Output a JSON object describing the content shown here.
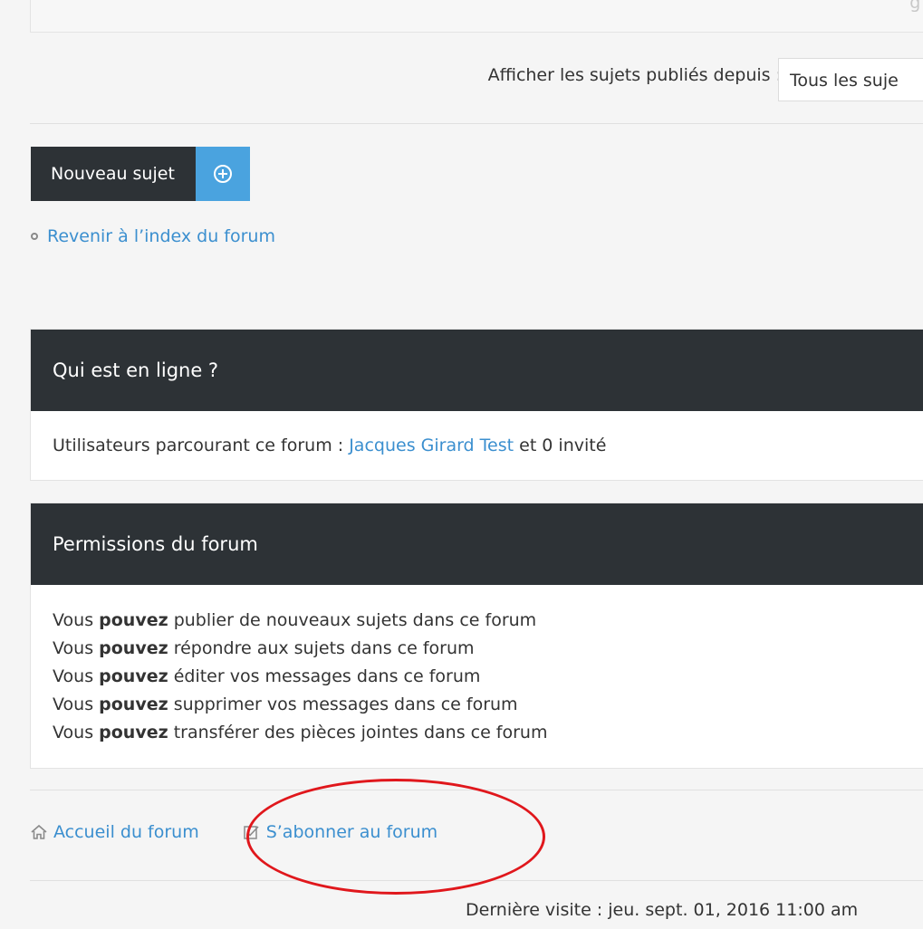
{
  "top": {
    "corner_text": "ge"
  },
  "filter": {
    "label": "Afficher les sujets publiés depuis :",
    "selected": "Tous les suje"
  },
  "actions": {
    "new_topic_label": "Nouveau sujet",
    "back_link": "Revenir à l’index du forum"
  },
  "online": {
    "title": "Qui est en ligne ?",
    "text_prefix": "Utilisateurs parcourant ce forum : ",
    "user": "Jacques Girard Test",
    "text_suffix": " et 0 invité"
  },
  "permissions": {
    "title": "Permissions du forum",
    "lead": "Vous ",
    "strong": "pouvez",
    "items": [
      " publier de nouveaux sujets dans ce forum",
      " répondre aux sujets dans ce forum",
      " éditer vos messages dans ce forum",
      " supprimer vos messages dans ce forum",
      " transférer des pièces jointes dans ce forum"
    ]
  },
  "footer": {
    "home_link": "Accueil du forum",
    "subscribe_link": "S’abonner au forum",
    "last_visit": "Dernière visite : jeu. sept. 01, 2016 11:00 am"
  },
  "colors": {
    "header_dark": "#2d3236",
    "accent_blue": "#4aa3df",
    "link_blue": "#3b8fcf",
    "annotation_red": "#e0171c"
  }
}
